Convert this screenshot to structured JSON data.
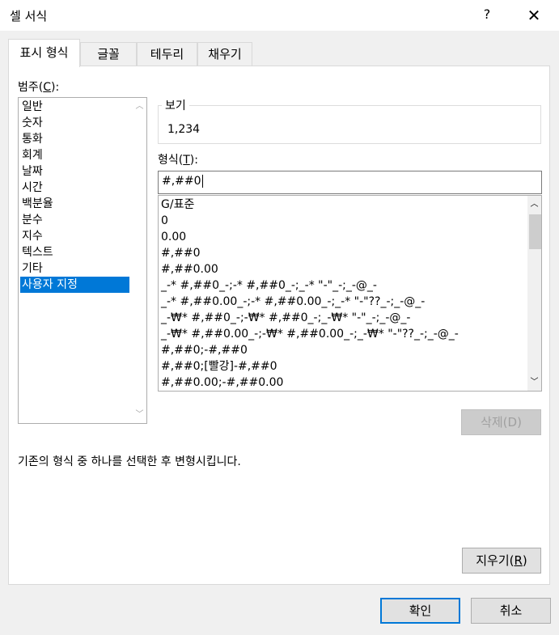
{
  "dialog": {
    "title": "셀 서식",
    "help": "?",
    "close": "✕"
  },
  "tabs": [
    "표시 형식",
    "글꼴",
    "테두리",
    "채우기"
  ],
  "active_tab": 0,
  "category": {
    "label_main": "범주(",
    "label_key": "C",
    "label_end": "):",
    "items": [
      "일반",
      "숫자",
      "통화",
      "회계",
      "날짜",
      "시간",
      "백분율",
      "분수",
      "지수",
      "텍스트",
      "기타",
      "사용자 지정"
    ],
    "selected_index": 11
  },
  "preview": {
    "legend": "보기",
    "value": "1,234"
  },
  "format": {
    "label_main": "형식(",
    "label_key": "T",
    "label_end": "):",
    "input_value": "#,##0",
    "items": [
      "G/표준",
      "0",
      "0.00",
      "#,##0",
      "#,##0.00",
      "_-* #,##0_-;-* #,##0_-;_-* \"-\"_-;_-@_-",
      "_-* #,##0.00_-;-* #,##0.00_-;_-* \"-\"??_-;_-@_-",
      "_-₩* #,##0_-;-₩* #,##0_-;_-₩* \"-\"_-;_-@_-",
      "_-₩* #,##0.00_-;-₩* #,##0.00_-;_-₩* \"-\"??_-;_-@_-",
      "#,##0;-#,##0",
      "#,##0;[빨강]-#,##0",
      "#,##0.00;-#,##0.00"
    ]
  },
  "delete_button": "삭제(D)",
  "description": "기존의 형식 중 하나를 선택한 후 변형시킵니다.",
  "clear_button": {
    "main": "지우기(",
    "key": "R",
    "end": ")"
  },
  "ok_button": "확인",
  "cancel_button": "취소",
  "colors": {
    "selection": "#0078d7",
    "accent_border": "#0078d7"
  }
}
